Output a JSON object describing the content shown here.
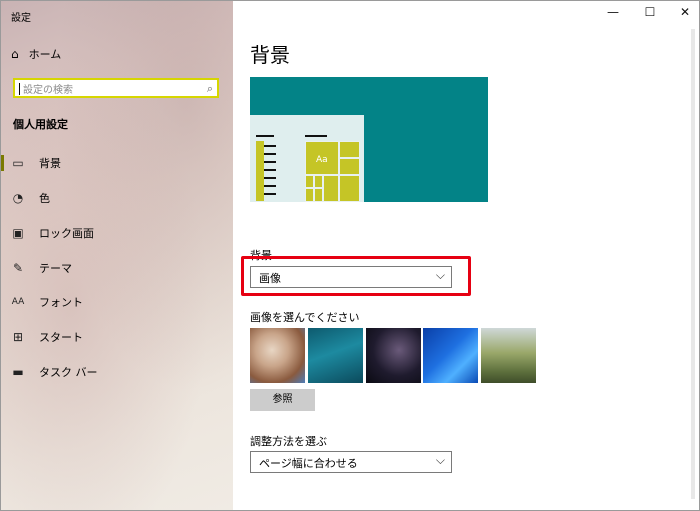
{
  "window": {
    "title": "設定",
    "minimize_icon": "minimize-icon",
    "maximize_icon": "maximize-icon",
    "close_icon": "close-icon"
  },
  "sidebar": {
    "home_label": "ホーム",
    "search_placeholder": "設定の検索",
    "section_title": "個人用設定",
    "items": [
      {
        "label": "背景",
        "icon": "image-icon",
        "active": true
      },
      {
        "label": "色",
        "icon": "palette-icon",
        "active": false
      },
      {
        "label": "ロック画面",
        "icon": "lock-screen-icon",
        "active": false
      },
      {
        "label": "テーマ",
        "icon": "theme-icon",
        "active": false
      },
      {
        "label": "フォント",
        "icon": "font-icon",
        "active": false
      },
      {
        "label": "スタート",
        "icon": "start-icon",
        "active": false
      },
      {
        "label": "タスク バー",
        "icon": "taskbar-icon",
        "active": false
      }
    ]
  },
  "main": {
    "title": "背景",
    "preview_sample_text": "Aa",
    "background_label": "背景",
    "background_value": "画像",
    "choose_picture_label": "画像を選んでください",
    "browse_button": "参照",
    "fit_label": "調整方法を選ぶ",
    "fit_value": "ページ幅に合わせる"
  },
  "colors": {
    "accent": "#038387",
    "tile": "#c5c526",
    "highlight": "#e60012"
  }
}
